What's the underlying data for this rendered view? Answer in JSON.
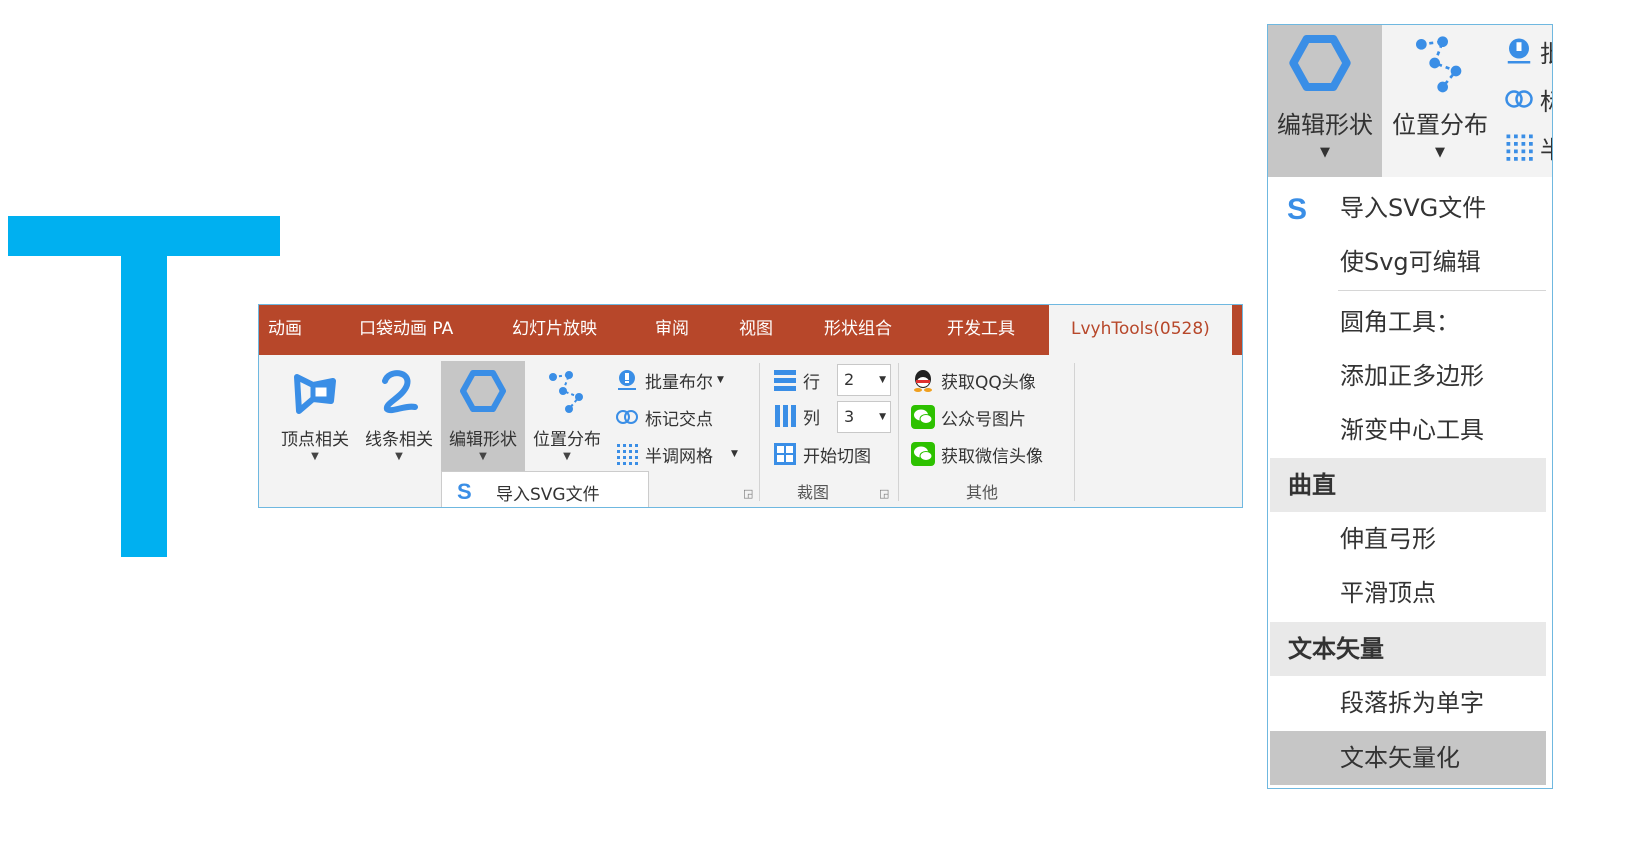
{
  "ribbon": {
    "tabs": [
      {
        "label": "动画"
      },
      {
        "label": "口袋动画 PA"
      },
      {
        "label": "幻灯片放映"
      },
      {
        "label": "审阅"
      },
      {
        "label": "视图"
      },
      {
        "label": "形状组合"
      },
      {
        "label": "开发工具"
      },
      {
        "label": "LvyhTools(0528)"
      }
    ],
    "active_tab": "LvyhTools(0528)",
    "big_buttons": [
      {
        "label": "顶点相关",
        "icon": "vertex-icon"
      },
      {
        "label": "线条相关",
        "icon": "curve-line-icon"
      },
      {
        "label": "编辑形状",
        "icon": "hexagon-icon"
      },
      {
        "label": "位置分布",
        "icon": "distribute-icon"
      }
    ],
    "small_buttons": [
      {
        "label": "批量布尔",
        "icon": "boolean-icon"
      },
      {
        "label": "标记交点",
        "icon": "intersect-icon"
      },
      {
        "label": "半调网格",
        "icon": "halftone-grid-icon"
      }
    ],
    "crop": {
      "rows_label": "行",
      "rows_value": "2",
      "cols_label": "列",
      "cols_value": "3",
      "start_label": "开始切图",
      "group_label": "裁图"
    },
    "other": {
      "items": [
        {
          "label": "获取QQ头像",
          "icon": "qq-icon"
        },
        {
          "label": "公众号图片",
          "icon": "wechat-icon"
        },
        {
          "label": "获取微信头像",
          "icon": "wechat-icon"
        }
      ],
      "group_label": "其他"
    },
    "dropdown_preview": "导入SVG文件"
  },
  "panel": {
    "big_buttons": [
      {
        "label": "编辑形状"
      },
      {
        "label": "位置分布"
      }
    ],
    "small_partial": [
      {
        "label": "批"
      },
      {
        "label": "标"
      },
      {
        "label": "半"
      }
    ],
    "menu": [
      {
        "type": "item",
        "label": "导入SVG文件",
        "icon": "svg-s-icon"
      },
      {
        "type": "item",
        "label": "使Svg可编辑"
      },
      {
        "type": "separator"
      },
      {
        "type": "item",
        "label": "圆角工具："
      },
      {
        "type": "item",
        "label": "添加正多边形"
      },
      {
        "type": "item",
        "label": "渐变中心工具"
      },
      {
        "type": "header",
        "label": "曲直"
      },
      {
        "type": "item",
        "label": "伸直弓形"
      },
      {
        "type": "item",
        "label": "平滑顶点"
      },
      {
        "type": "header",
        "label": "文本矢量"
      },
      {
        "type": "item",
        "label": "段落拆为单字"
      },
      {
        "type": "item",
        "label": "文本矢量化",
        "selected": true
      }
    ]
  },
  "colors": {
    "accent_blue": "#00b0f0",
    "tab_bar": "#b7472a",
    "icon_blue": "#3a8ee6",
    "pressed": "#c6c6c6"
  }
}
